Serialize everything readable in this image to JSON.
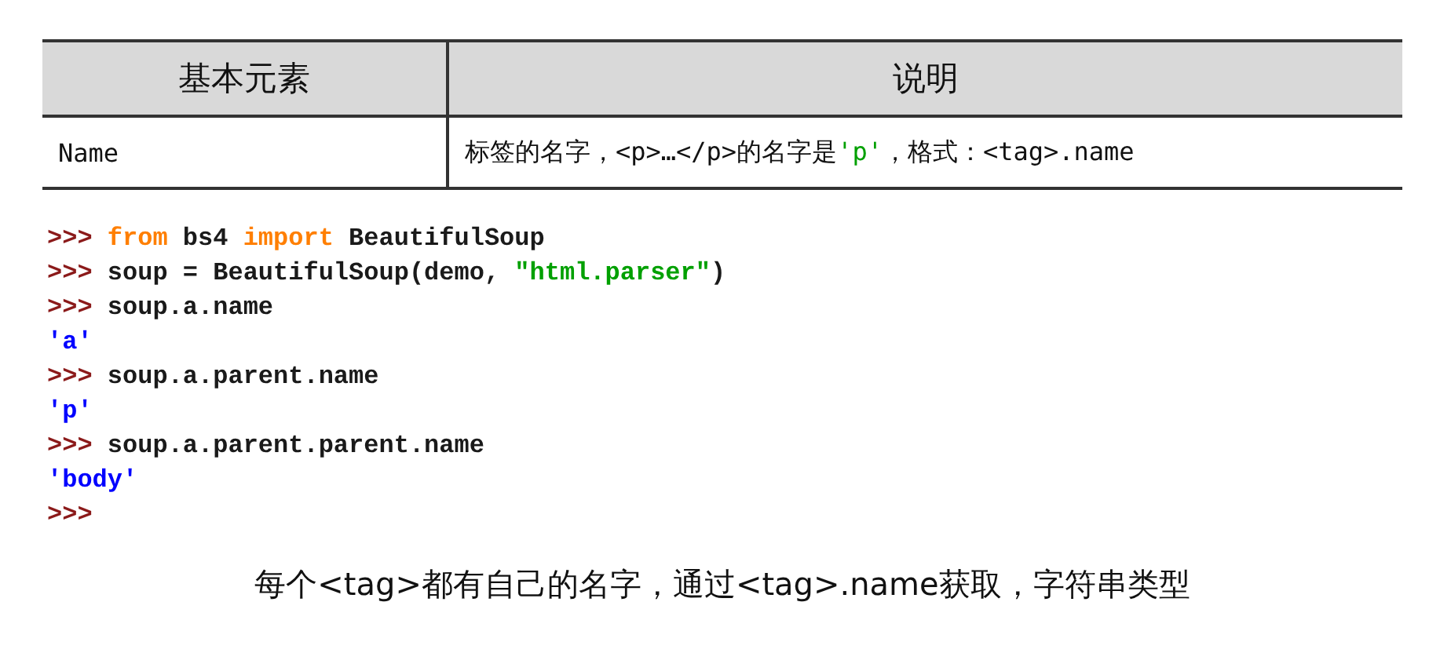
{
  "table": {
    "columns": [
      "基本元素",
      "说明"
    ],
    "rows": [
      {
        "element": "Name",
        "description": [
          {
            "kind": "text",
            "text": "标签的名字，<p>…</p>的名字是"
          },
          {
            "kind": "string",
            "text": "'p'"
          },
          {
            "kind": "text",
            "text": "，格式：<tag>.name"
          }
        ]
      }
    ]
  },
  "code": [
    [
      {
        "kind": "prompt",
        "text": ">>> "
      },
      {
        "kind": "keyword",
        "text": "from"
      },
      {
        "kind": "plain",
        "text": " bs4 "
      },
      {
        "kind": "keyword",
        "text": "import"
      },
      {
        "kind": "plain",
        "text": " BeautifulSoup"
      }
    ],
    [
      {
        "kind": "prompt",
        "text": ">>> "
      },
      {
        "kind": "plain",
        "text": "soup = BeautifulSoup(demo, "
      },
      {
        "kind": "string",
        "text": "\"html.parser\""
      },
      {
        "kind": "plain",
        "text": ")"
      }
    ],
    [
      {
        "kind": "prompt",
        "text": ">>> "
      },
      {
        "kind": "plain",
        "text": "soup.a.name"
      }
    ],
    [
      {
        "kind": "output",
        "text": "'a'"
      }
    ],
    [
      {
        "kind": "prompt",
        "text": ">>> "
      },
      {
        "kind": "plain",
        "text": "soup.a.parent.name"
      }
    ],
    [
      {
        "kind": "output",
        "text": "'p'"
      }
    ],
    [
      {
        "kind": "prompt",
        "text": ">>> "
      },
      {
        "kind": "plain",
        "text": "soup.a.parent.parent.name"
      }
    ],
    [
      {
        "kind": "output",
        "text": "'body'"
      }
    ],
    [
      {
        "kind": "prompt",
        "text": ">>>"
      }
    ]
  ],
  "caption": "每个<tag>都有自己的名字，通过<tag>.name获取，字符串类型"
}
